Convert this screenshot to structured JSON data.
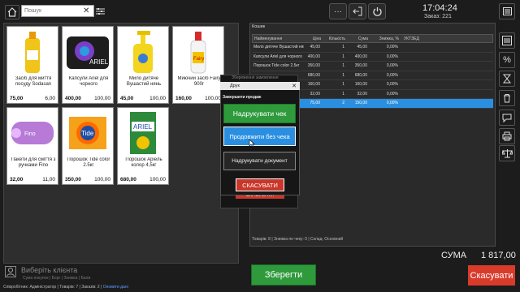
{
  "search": {
    "placeholder": "Пошук"
  },
  "header": {
    "time": "17:04:24",
    "order": "Заказ: 221"
  },
  "products": [
    {
      "name": "Засіб для миття посуду Sodasan",
      "price": "75,00",
      "qty": "6,00",
      "icon": "yellow-bottle"
    },
    {
      "name": "Капсули Ariel для чорного",
      "price": "400,00",
      "qty": "100,00",
      "icon": "capsules-box"
    },
    {
      "name": "Мило дитяче Вушастий нянь",
      "price": "45,00",
      "qty": "100,00",
      "icon": "soap-bottle"
    },
    {
      "name": "Миючий засіб Fairy 900г",
      "price": "160,00",
      "qty": "100,00",
      "icon": "fairy-bottle"
    },
    {
      "name": "Пакети для сміття з ручками Fino",
      "price": "32,00",
      "qty": "11,00",
      "icon": "trash-bags"
    },
    {
      "name": "Порошок Tide color 2.5кг",
      "price": "350,00",
      "qty": "100,00",
      "icon": "tide-box"
    },
    {
      "name": "Порошок Аріель колор 4,5кг",
      "price": "680,00",
      "qty": "100,00",
      "icon": "ariel-box"
    }
  ],
  "receipt": {
    "title": "Кошик",
    "columns": [
      "Найменування",
      "Ціна",
      "Кількість",
      "Сума",
      "Знижка, %",
      "УКТЗЕД"
    ],
    "rows": [
      {
        "name": "Мило дитяче Вушастий нянь",
        "price": "45,00",
        "qty": "1",
        "sum": "45,00",
        "disc": "0,00%",
        "selected": false
      },
      {
        "name": "Капсули Ariel для чорного",
        "price": "400,00",
        "qty": "1",
        "sum": "400,00",
        "disc": "0,00%",
        "selected": false
      },
      {
        "name": "Порошок Tide color 2.5кг",
        "price": "350,00",
        "qty": "1",
        "sum": "350,00",
        "disc": "0,00%",
        "selected": false
      },
      {
        "name": "",
        "price": "680,00",
        "qty": "1",
        "sum": "680,00",
        "disc": "0,00%",
        "selected": false
      },
      {
        "name": "",
        "price": "160,00",
        "qty": "1",
        "sum": "160,00",
        "disc": "0,00%",
        "selected": false
      },
      {
        "name": "",
        "price": "32,00",
        "qty": "1",
        "sum": "32,00",
        "disc": "0,00%",
        "selected": false
      },
      {
        "name": "",
        "price": "75,00",
        "qty": "2",
        "sum": "150,00",
        "disc": "0,00%",
        "selected": true
      }
    ],
    "footer": "Товарів: 8  |  Знижка по чеку: 0  |  Склад: Основний"
  },
  "totals": {
    "label": "СУМА",
    "value": "1 817,00"
  },
  "buttons": {
    "save": "Зберегти",
    "cancel": "Скасувати"
  },
  "client": {
    "label": "Виберіть клієнта",
    "sub": "Сума покупок  |  Борг  |  Знижка  |  Бали"
  },
  "status": {
    "employee_label": "Співробітник:",
    "employee": "Адміністратор",
    "goods_label": "Товарів:",
    "goods": "7",
    "orders_label": "Заказів:",
    "orders": "2",
    "link": "Оновити дані"
  },
  "dialog": {
    "back_title": "Збереження замовлення",
    "bar_title": "Друк",
    "heading": "Завершити продаж",
    "print": "Надрукувати чек",
    "continue": "Продовжити без чека",
    "document": "Надрукувати документ",
    "cancel": "СКАСУВАТИ",
    "cancel_back": "СКАСУВАТИ"
  }
}
